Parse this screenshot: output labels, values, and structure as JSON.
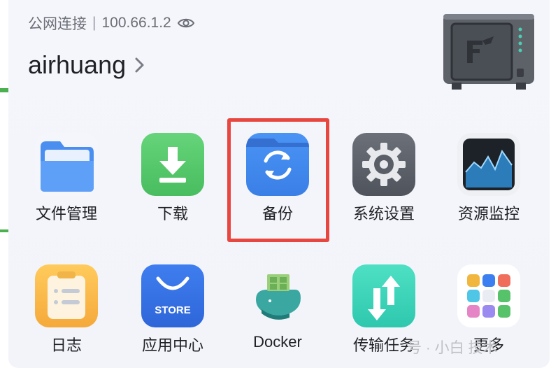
{
  "header": {
    "connection_label": "公网连接",
    "separator": "|",
    "ip_address": "100.66.1.2",
    "username": "airhuang"
  },
  "apps": [
    {
      "label": "文件管理",
      "icon": "folder-icon"
    },
    {
      "label": "下载",
      "icon": "download-icon"
    },
    {
      "label": "备份",
      "icon": "backup-sync-icon"
    },
    {
      "label": "系统设置",
      "icon": "gear-icon"
    },
    {
      "label": "资源监控",
      "icon": "activity-monitor-icon"
    },
    {
      "label": "日志",
      "icon": "clipboard-log-icon"
    },
    {
      "label": "应用中心",
      "icon": "store-bag-icon",
      "icon_text": "STORE"
    },
    {
      "label": "Docker",
      "icon": "docker-whale-icon"
    },
    {
      "label": "传输任务",
      "icon": "transfer-arrows-icon"
    },
    {
      "label": "更多",
      "icon": "more-grid-icon"
    }
  ],
  "watermark": "号 · 小白    技术",
  "colors": {
    "highlight_border": "#e8473f",
    "accent_blue": "#3f8cf2",
    "download_green": "#5acb6e"
  }
}
